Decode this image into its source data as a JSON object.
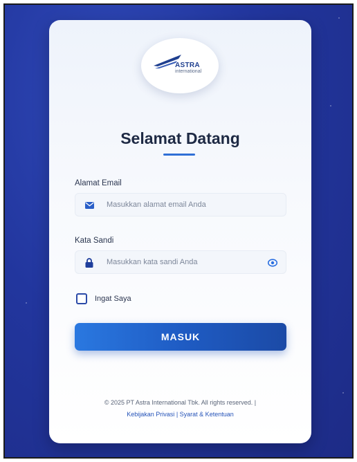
{
  "logo": {
    "brand": "ASTRA",
    "sub": "international"
  },
  "login": {
    "title": "Selamat Datang",
    "email_label": "Alamat Email",
    "email_placeholder": "Masukkan alamat email Anda",
    "password_label": "Kata Sandi",
    "password_placeholder": "Masukkan kata sandi Anda",
    "remember_label": "Ingat Saya",
    "submit_label": "MASUK"
  },
  "footer": {
    "copyright": "© 2025 PT Astra International Tbk. All rights reserved. |",
    "privacy_link": "Kebijakan Privasi",
    "separator": "|",
    "terms_link": "Syarat & Ketentuan"
  },
  "colors": {
    "background": "#22369e",
    "accent": "#1f5cc4",
    "title": "#1e2a44",
    "link": "#2452b8"
  },
  "icons": {
    "email": "envelope-icon",
    "password": "lock-icon",
    "toggle": "eye-icon"
  }
}
